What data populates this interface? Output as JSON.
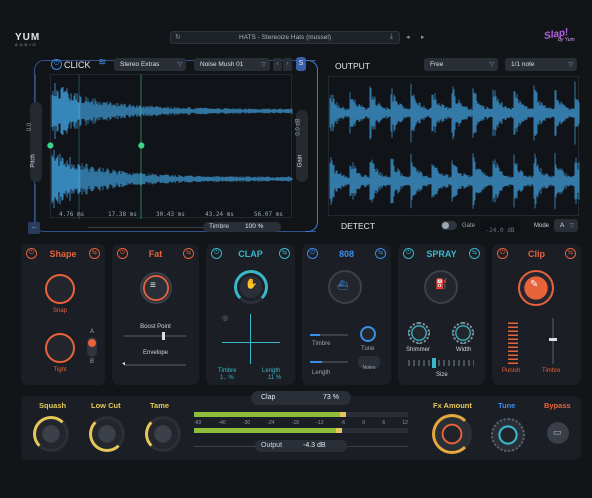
{
  "header": {
    "logo_top": "YUM",
    "logo_bottom": "AUDIO",
    "preset_name": "HATS - Stereoize Hats (mussel)",
    "brand": "Slap!",
    "brand_by": "by Yum"
  },
  "click": {
    "title": "CLICK",
    "dropdown1": "Stereo Extras",
    "dropdown2": "Noise Mush 01",
    "solo_label": "S",
    "pitch_value": "0.0",
    "pitch_label": "Pitch",
    "gain_value": "0.0 dB",
    "gain_label": "Gain",
    "time_markers": [
      "4.76 ms",
      "17.38 ms",
      "30.43 ms",
      "43.24 ms",
      "56.07 ms"
    ],
    "timbre_label": "Timbre",
    "timbre_value": "100 %"
  },
  "output": {
    "title": "OUTPUT",
    "mode_dropdown": "Free",
    "rate_dropdown": "1/1 note",
    "detect_label": "DETECT",
    "gate_label": "Gate",
    "gate_value": "-24.0 dB",
    "mode_label": "Mode",
    "mode_value": "A"
  },
  "modules": [
    {
      "title": "Shape",
      "color": "#e8623a",
      "label1": "Snap",
      "label2": "Tight",
      "switch_a": "A",
      "switch_b": "B"
    },
    {
      "title": "Fat",
      "color": "#e8623a",
      "label1": "Boost Point",
      "label2": "Envelope"
    },
    {
      "title": "CLAP",
      "color": "#39b7c9",
      "label1": "Timbre",
      "label2": "Length",
      "value1": "1.. %",
      "value2": "11 %"
    },
    {
      "title": "808",
      "color": "#3a8ee8",
      "label1": "Timbre",
      "label2": "Length",
      "label3": "Tune",
      "label4": "Notes"
    },
    {
      "title": "SPRAY",
      "color": "#39b7c9",
      "label1": "Shimmer",
      "label2": "Width",
      "label3": "Size"
    },
    {
      "title": "Clip",
      "color": "#e8623a",
      "label1": "Punish",
      "label2": "Timbre"
    }
  ],
  "bottom": {
    "squash_label": "Squash",
    "lowcut_label": "Low Cut",
    "tame_label": "Tame",
    "clap_label": "Clap",
    "clap_value": "73 %",
    "meter_ticks": [
      "-60",
      "-40",
      "-30",
      "-24",
      "-18",
      "-12",
      "-6",
      "0",
      "6",
      "12"
    ],
    "output_label": "Output",
    "output_value": "-4.3 dB",
    "fx_amount_label": "Fx Amount",
    "tune_label": "Tune",
    "bypass_label": "Bypass"
  },
  "colors": {
    "accent_orange": "#e8623a",
    "accent_cyan": "#39b7c9",
    "accent_blue": "#3a8ee8",
    "waveform": "#3f9bd6",
    "label_yellow": "#e6c85a",
    "meter_green": "#8fbf3a"
  },
  "icons": {
    "power": "power-icon",
    "link": "link-icon",
    "layers": "layers-icon",
    "lock": "lock-icon",
    "back": "back-icon",
    "forward": "forward-icon"
  }
}
